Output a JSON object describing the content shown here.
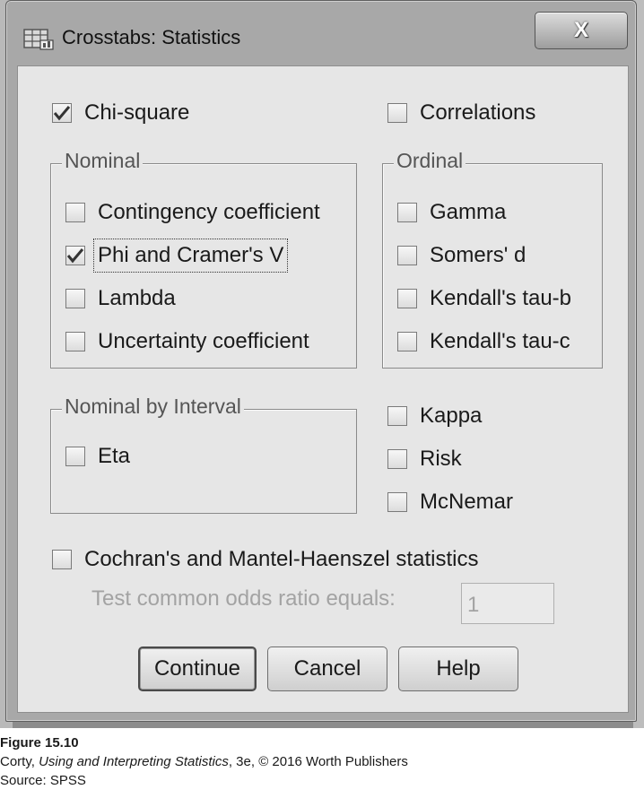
{
  "window": {
    "title": "Crosstabs: Statistics",
    "close_glyph": "X"
  },
  "options": {
    "chi_square": {
      "label": "Chi-square",
      "checked": true
    },
    "correlations": {
      "label": "Correlations",
      "checked": false
    }
  },
  "nominal": {
    "title": "Nominal",
    "items": [
      {
        "label": "Contingency coefficient",
        "checked": false
      },
      {
        "label": "Phi and Cramer's V",
        "checked": true
      },
      {
        "label": "Lambda",
        "checked": false
      },
      {
        "label": "Uncertainty coefficient",
        "checked": false
      }
    ]
  },
  "ordinal": {
    "title": "Ordinal",
    "items": [
      {
        "label": "Gamma",
        "checked": false
      },
      {
        "label": "Somers' d",
        "checked": false
      },
      {
        "label": "Kendall's tau-b",
        "checked": false
      },
      {
        "label": "Kendall's tau-c",
        "checked": false
      }
    ]
  },
  "nominal_by_interval": {
    "title": "Nominal by Interval",
    "items": [
      {
        "label": "Eta",
        "checked": false
      }
    ]
  },
  "other": {
    "items": [
      {
        "label": "Kappa",
        "checked": false
      },
      {
        "label": "Risk",
        "checked": false
      },
      {
        "label": "McNemar",
        "checked": false
      }
    ]
  },
  "cochran": {
    "label": "Cochran's and Mantel-Haenszel statistics",
    "checked": false,
    "odds_label": "Test common odds ratio equals:",
    "odds_value": "1"
  },
  "buttons": {
    "continue": "Continue",
    "cancel": "Cancel",
    "help": "Help"
  },
  "caption": {
    "figure": "Figure 15.10",
    "credit_author": "Corty, ",
    "credit_title": "Using and Interpreting Statistics",
    "credit_rest": ", 3e, © 2016 Worth Publishers",
    "source": "Source: SPSS"
  },
  "colors": {
    "dialog_bg": "#e6e6e6",
    "frame": "#a8a8a8",
    "disabled_text": "#a3a3a3"
  }
}
